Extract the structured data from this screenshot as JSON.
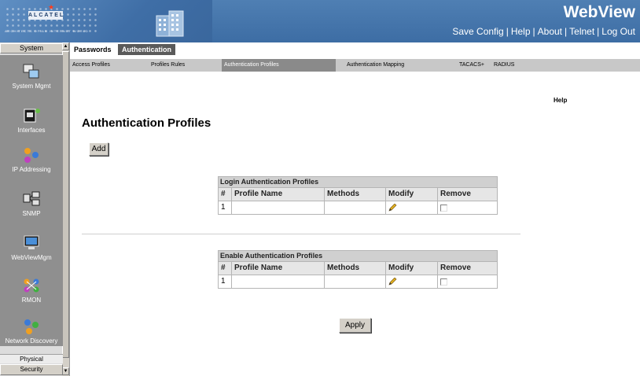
{
  "header": {
    "brand": "ALCATEL",
    "tagline": "ARCHITECTS OF AN INTERNET WORLD",
    "app_title": "WebView",
    "links": [
      "Save Config",
      "Help",
      "About",
      "Telnet",
      "Log Out"
    ]
  },
  "sidebar": {
    "title": "System",
    "items": [
      {
        "label": "System Mgmt",
        "icon": "system-mgmt-icon"
      },
      {
        "label": "Interfaces",
        "icon": "interfaces-icon"
      },
      {
        "label": "IP Addressing",
        "icon": "ip-addressing-icon"
      },
      {
        "label": "SNMP",
        "icon": "snmp-icon"
      },
      {
        "label": "WebViewMgm",
        "icon": "webview-mgmt-icon"
      },
      {
        "label": "RMON",
        "icon": "rmon-icon"
      },
      {
        "label": "Network Discovery",
        "icon": "network-discovery-icon"
      }
    ],
    "physical": "Physical",
    "security": "Security"
  },
  "tabs": [
    "Passwords",
    "Authentication"
  ],
  "active_tab": "Authentication",
  "subnav": [
    "Access Profiles",
    "Profiles Rules",
    "Authentication Profiles",
    "Authentication Mapping",
    "TACACS+",
    "RADIUS"
  ],
  "active_subnav": "Authentication Profiles",
  "main": {
    "help": "Help",
    "title": "Authentication Profiles",
    "add_label": "Add",
    "apply_label": "Apply",
    "columns": [
      "#",
      "Profile Name",
      "Methods",
      "Modify",
      "Remove"
    ],
    "login_table": {
      "caption": "Login Authentication Profiles",
      "rows": [
        {
          "index": "1",
          "name": "",
          "methods": ""
        }
      ]
    },
    "enable_table": {
      "caption": "Enable Authentication Profiles",
      "rows": [
        {
          "index": "1",
          "name": "",
          "methods": ""
        }
      ]
    }
  },
  "colors": {
    "header_blue": "#3d6da4",
    "sidebar_gray": "#8f8f8f",
    "active_subnav": "#8a8a8a",
    "table_header": "#d0d0d0"
  }
}
